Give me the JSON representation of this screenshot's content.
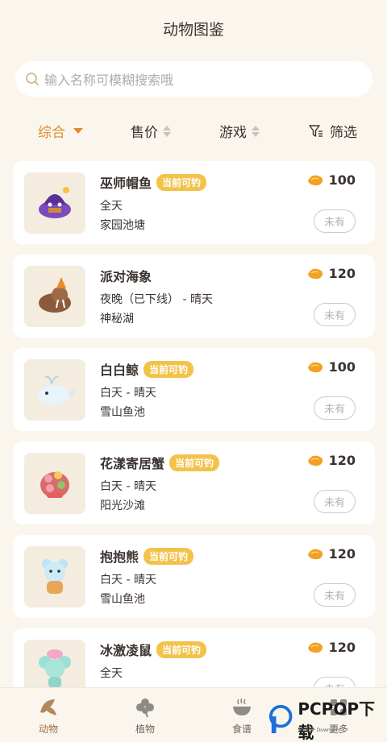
{
  "header": {
    "title": "动物图鉴"
  },
  "search": {
    "placeholder": "输入名称可模糊搜索哦"
  },
  "sort": {
    "items": [
      {
        "label": "综合"
      },
      {
        "label": "售价"
      },
      {
        "label": "游戏"
      },
      {
        "label": "筛选"
      }
    ]
  },
  "colors": {
    "accent": "#e08c2e",
    "badge": "#f2c24a",
    "background": "#faf6ee",
    "card": "#ffffff"
  },
  "animals": [
    {
      "name": "巫师帽鱼",
      "badge": "当前可钓",
      "time": "全天",
      "location": "家园池塘",
      "price": "100",
      "owned": "未有",
      "icon": "wizard-hat-fish-icon"
    },
    {
      "name": "派对海象",
      "badge": "",
      "time": "夜晚（已下线） - 晴天",
      "location": "神秘湖",
      "price": "120",
      "owned": "未有",
      "icon": "party-walrus-icon"
    },
    {
      "name": "白白鲸",
      "badge": "当前可钓",
      "time": "白天 - 晴天",
      "location": "雪山鱼池",
      "price": "100",
      "owned": "未有",
      "icon": "white-whale-icon"
    },
    {
      "name": "花漾寄居蟹",
      "badge": "当前可钓",
      "time": "白天 - 晴天",
      "location": "阳光沙滩",
      "price": "120",
      "owned": "未有",
      "icon": "flower-hermit-crab-icon"
    },
    {
      "name": "抱抱熊",
      "badge": "当前可钓",
      "time": "白天 - 晴天",
      "location": "雪山鱼池",
      "price": "120",
      "owned": "未有",
      "icon": "hug-bear-icon"
    },
    {
      "name": "冰激凌鼠",
      "badge": "当前可钓",
      "time": "全天",
      "location": "",
      "price": "120",
      "owned": "未有",
      "icon": "ice-cream-mouse-icon"
    }
  ],
  "tabbar": {
    "items": [
      {
        "label": "动物",
        "icon": "fish-icon"
      },
      {
        "label": "植物",
        "icon": "clover-icon"
      },
      {
        "label": "食谱",
        "icon": "bowl-icon"
      },
      {
        "label": "更多",
        "icon": "grid-icon"
      }
    ]
  },
  "watermark": {
    "text": "PCPOP下载",
    "small": "PCPOP Download"
  }
}
